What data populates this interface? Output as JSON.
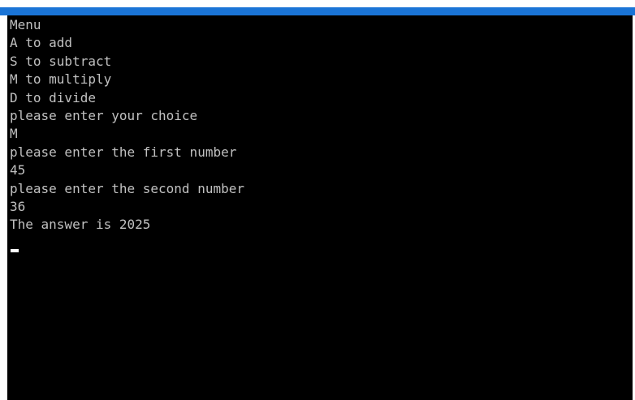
{
  "console": {
    "lines": [
      "Menu",
      "A to add",
      "S to subtract",
      "M to multiply",
      "D to divide",
      "please enter your choice",
      "M",
      "please enter the first number",
      "45",
      "please enter the second number",
      "36",
      "The answer is 2025"
    ]
  },
  "colors": {
    "title_bar": "#1a74d6",
    "background": "#000000",
    "text": "#c0c0c0",
    "cursor": "#ffffff"
  }
}
